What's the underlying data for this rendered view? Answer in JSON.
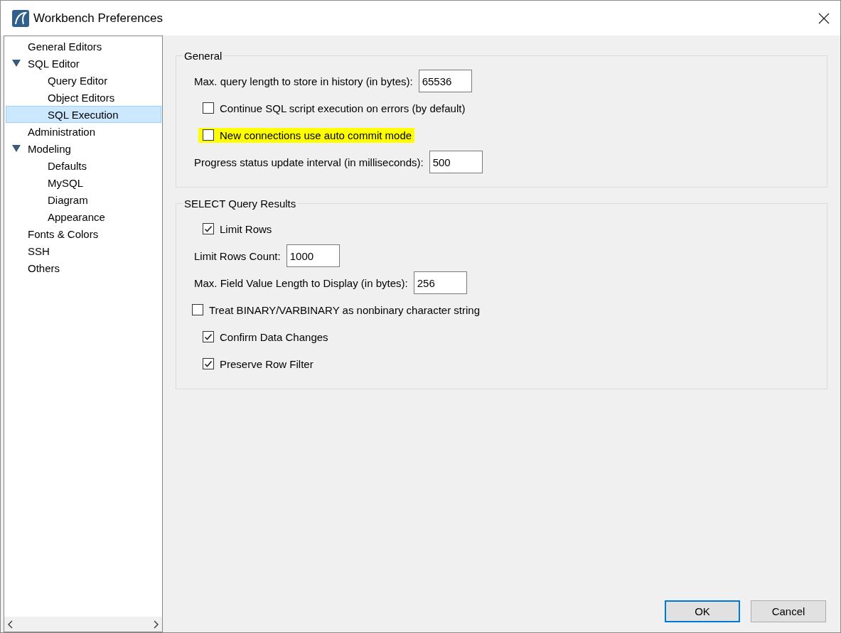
{
  "window": {
    "title": "Workbench Preferences"
  },
  "sidebar": {
    "items": [
      {
        "label": "General Editors",
        "selected": false
      },
      {
        "label": "SQL Editor",
        "selected": false,
        "expanded": true,
        "children": [
          {
            "label": "Query Editor",
            "selected": false
          },
          {
            "label": "Object Editors",
            "selected": false
          },
          {
            "label": "SQL Execution",
            "selected": true
          }
        ]
      },
      {
        "label": "Administration",
        "selected": false
      },
      {
        "label": "Modeling",
        "selected": false,
        "expanded": true,
        "children": [
          {
            "label": "Defaults",
            "selected": false
          },
          {
            "label": "MySQL",
            "selected": false
          },
          {
            "label": "Diagram",
            "selected": false
          },
          {
            "label": "Appearance",
            "selected": false
          }
        ]
      },
      {
        "label": "Fonts & Colors",
        "selected": false
      },
      {
        "label": "SSH",
        "selected": false
      },
      {
        "label": "Others",
        "selected": false
      }
    ]
  },
  "groups": [
    {
      "title": "General",
      "rows": [
        {
          "kind": "field",
          "label": "Max. query length to store in history (in bytes):",
          "value": "65536"
        },
        {
          "kind": "checkbox",
          "label": "Continue SQL script execution on errors (by default)",
          "checked": false,
          "indented": true,
          "highlighted": false
        },
        {
          "kind": "checkbox",
          "label": "New connections use auto commit mode",
          "checked": false,
          "indented": true,
          "highlighted": true
        },
        {
          "kind": "field",
          "label": "Progress status update interval (in milliseconds):",
          "value": "500"
        }
      ]
    },
    {
      "title": "SELECT Query Results",
      "rows": [
        {
          "kind": "checkbox",
          "label": "Limit Rows",
          "checked": true,
          "indented": true,
          "highlighted": false
        },
        {
          "kind": "field",
          "label": "Limit Rows Count:",
          "value": "1000"
        },
        {
          "kind": "field",
          "label": "Max. Field Value Length to Display (in bytes):",
          "value": "256"
        },
        {
          "kind": "checkbox",
          "label": "Treat BINARY/VARBINARY as nonbinary character string",
          "checked": false,
          "indented": false,
          "highlighted": false
        },
        {
          "kind": "checkbox",
          "label": "Confirm Data Changes",
          "checked": true,
          "indented": true,
          "highlighted": false
        },
        {
          "kind": "checkbox",
          "label": "Preserve Row Filter",
          "checked": true,
          "indented": true,
          "highlighted": false
        }
      ]
    }
  ],
  "buttons": [
    {
      "label": "OK",
      "kind": "default"
    },
    {
      "label": "Cancel",
      "kind": "normal"
    }
  ]
}
